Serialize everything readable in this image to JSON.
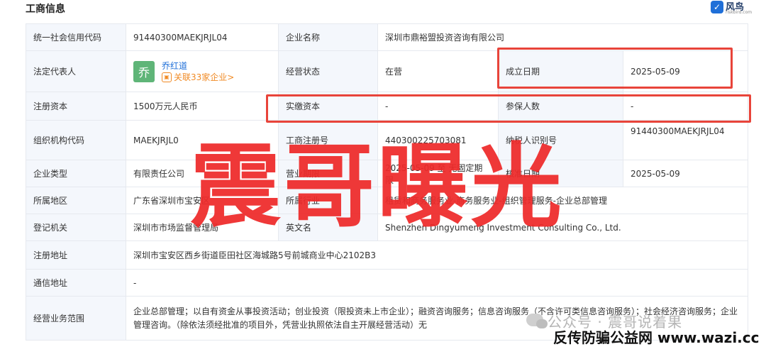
{
  "section_title": "工商信息",
  "brand": {
    "name": "风鸟",
    "domain": "riskbird.com"
  },
  "rows": [
    {
      "cells": [
        {
          "label": "统一社会信用代码",
          "value": "91440300MAEKJRJL04"
        },
        {
          "label": "企业名称",
          "value": "深圳市鼎裕盟投资咨询有限公司"
        }
      ]
    },
    {
      "legal_label": "法定代表人",
      "legal_avatar": "乔",
      "legal_name": "乔红道",
      "legal_related": "关联33家企业>",
      "cells": [
        {
          "label": "经营状态",
          "value": "在营"
        },
        {
          "label": "成立日期",
          "value": "2025-05-09"
        }
      ]
    },
    {
      "cells": [
        {
          "label": "注册资本",
          "value": "1500万元人民币"
        },
        {
          "label": "实缴资本",
          "value": "-"
        },
        {
          "label": "参保人数",
          "value": "-"
        }
      ]
    },
    {
      "cells": [
        {
          "label": "组织机构代码",
          "value": "MAEKJRJL0"
        },
        {
          "label": "工商注册号",
          "value": "440300225703081"
        },
        {
          "label": "纳税人识别号",
          "value": "91440300MAEKJRJL04"
        }
      ]
    },
    {
      "cells": [
        {
          "label": "企业类型",
          "value": "有限责任公司"
        },
        {
          "label": "营业期限",
          "value": "2025-05-09 至 无固定期限"
        },
        {
          "label": "核准日期",
          "value": "2025-05-09"
        }
      ]
    },
    {
      "cells": [
        {
          "label": "所属地区",
          "value": "广东省深圳市宝安区"
        },
        {
          "label": "所属行业",
          "value": "租赁和商务服务业-商务服务业-组织管理服务-企业总部管理"
        }
      ]
    },
    {
      "cells": [
        {
          "label": "登记机关",
          "value": "深圳市市场监督管理局"
        },
        {
          "label": "英文名",
          "value": "Shenzhen Dingyumeng Investment Consulting Co., Ltd."
        }
      ]
    },
    {
      "cells": [
        {
          "label": "注册地址",
          "value": "深圳市宝安区西乡街道臣田社区海城路5号前城商业中心2102B3"
        }
      ]
    },
    {
      "cells": [
        {
          "label": "通信地址",
          "value": "-"
        }
      ]
    },
    {
      "cells": [
        {
          "label": "经营业务范围",
          "value": "企业总部管理；以自有资金从事投资活动；创业投资（限投资未上市企业）；融资咨询服务；信息咨询服务（不含许可类信息咨询服务）；社会经济咨询服务；企业管理咨询。（除依法须经批准的项目外，凭营业执照依法自主开展经营活动）无"
        }
      ]
    }
  ],
  "watermark": "震哥曝光",
  "footer": {
    "account": "公众号 · 震哥说着果",
    "site": "反传防骗公益网 www.wazi.cc"
  },
  "colors": {
    "highlight": "#e8443a",
    "watermark": "#ee2a2a",
    "link": "#1f6fd8",
    "accent_orange": "#f08a24"
  }
}
